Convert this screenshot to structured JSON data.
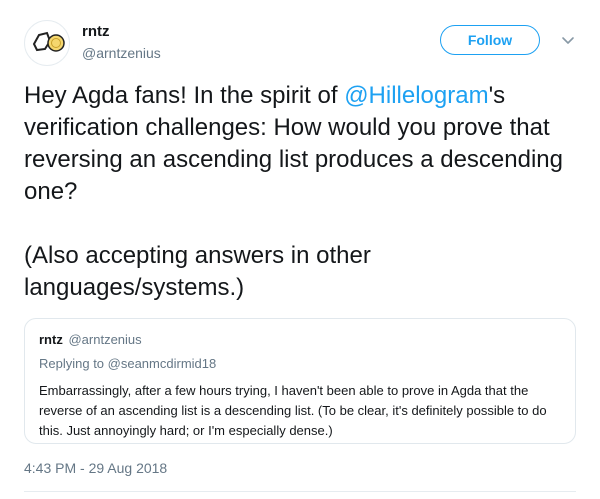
{
  "author": {
    "name": "rntz",
    "handle": "@arntzenius",
    "avatar_icon": "avatar-logo"
  },
  "follow": {
    "label": "Follow"
  },
  "menu": {
    "icon": "chevron-down-icon"
  },
  "tweet": {
    "text_before": "Hey Agda fans! In the spirit of ",
    "mention": "@Hillelogram",
    "text_after": "'s verification challenges: How would you prove that reversing an ascending list produces a descending one?",
    "second_paragraph": "(Also accepting answers in other languages/systems.)"
  },
  "quoted": {
    "name": "rntz",
    "handle": "@arntzenius",
    "replying_to": "Replying to @seanmcdirmid18",
    "body": "Embarrassingly, after a few hours trying, I haven't been able to prove in Agda that the reverse of an ascending list is a descending list. (To be clear, it's definitely possible to do this. Just annoyingly hard; or I'm especially dense.)"
  },
  "timestamp": "4:43 PM - 29 Aug 2018",
  "colors": {
    "accent": "#1da1f2",
    "secondary_text": "#657786",
    "border": "#e1e8ed"
  }
}
